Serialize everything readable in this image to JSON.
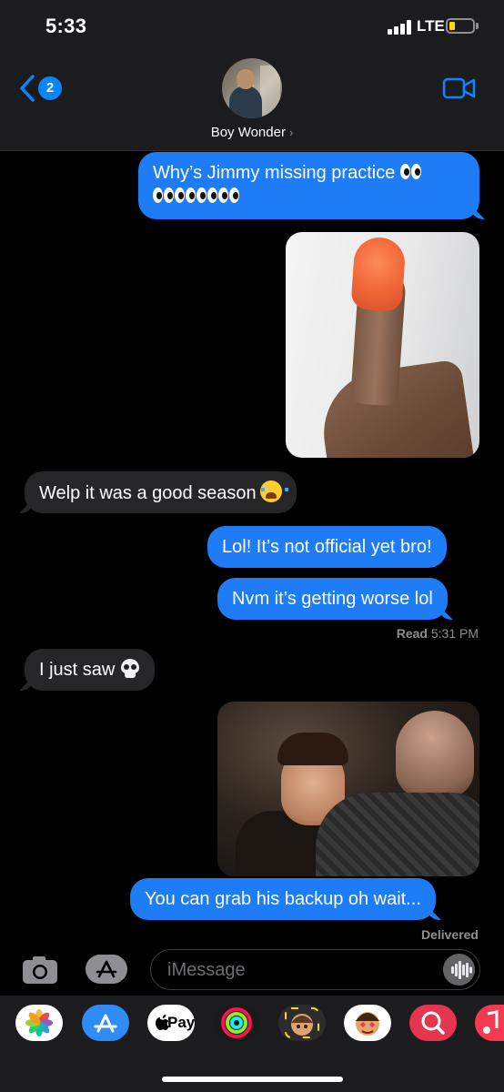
{
  "status_bar": {
    "time": "5:33",
    "network": "LTE"
  },
  "nav": {
    "back_count": "2",
    "contact_name": "Boy Wonder",
    "contact_chevron": "›",
    "icons": {
      "back": "chevron-left-icon",
      "video": "video-camera-icon"
    }
  },
  "messages": {
    "m1": {
      "text": "Why’s Jimmy missing practice",
      "direction": "sent",
      "emoji": "eyes x5"
    },
    "m2": {
      "type": "image",
      "direction": "sent",
      "subject": "thumb"
    },
    "m3": {
      "text": "Welp it was a good season",
      "direction": "received",
      "emoji": "loudly-crying-face"
    },
    "m4": {
      "text": "Lol! It’s not official yet bro!",
      "direction": "sent"
    },
    "m5": {
      "text": "Nvm it’s getting worse lol",
      "direction": "sent"
    },
    "read_receipt": {
      "label": "Read",
      "time": "5:31 PM"
    },
    "m6": {
      "text": "I just saw",
      "direction": "received",
      "emoji": "skull"
    },
    "m7": {
      "type": "image",
      "direction": "sent",
      "subject": "laughing man"
    },
    "m8": {
      "text": "You can grab his backup  oh wait...",
      "direction": "sent"
    },
    "delivered_receipt": {
      "label": "Delivered"
    }
  },
  "compose": {
    "placeholder": "iMessage",
    "icons": {
      "camera": "camera-icon",
      "apps": "app-store-icon",
      "audio": "audio-waveform-icon"
    }
  },
  "app_drawer": {
    "apps": [
      "Photos",
      "App Store",
      "Pay",
      "Activity",
      "Memoji",
      "Animoji",
      "Search",
      "Music"
    ],
    "pay_label": "Pay"
  },
  "colors": {
    "sent_bubble": "#1e7cf7",
    "received_bubble": "#262628",
    "accent": "#0a84ff",
    "background": "#000000"
  }
}
